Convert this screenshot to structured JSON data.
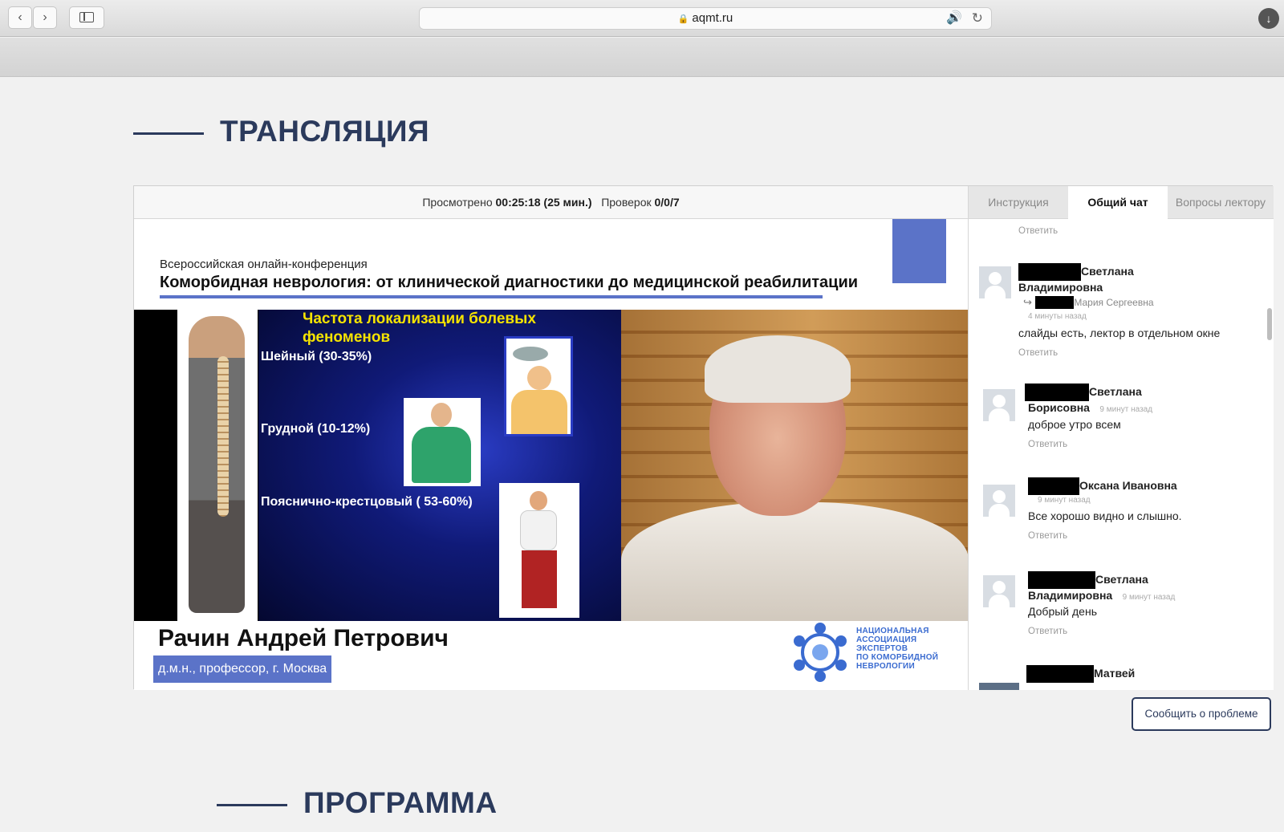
{
  "browser": {
    "url": "aqmt.ru",
    "back_icon": "chevron-left-icon",
    "forward_icon": "chevron-right-icon",
    "sidebar_icon": "sidebar-icon"
  },
  "page": {
    "broadcast_title": "ТРАНСЛЯЦИЯ",
    "program_title": "ПРОГРАММА",
    "report_button": "Сообщить о проблеме"
  },
  "stats": {
    "watched_label": "Просмотрено",
    "watched_value": "00:25:18 (25 мин.)",
    "checks_label": "Проверок",
    "checks_value": "0/0/7"
  },
  "video": {
    "conf_subtitle": "Всероссийская онлайн-конференция",
    "conf_title": "Коморбидная неврология: от клинической диагностики до медицинской реабилитации",
    "slide_heading_line1": "Частота локализации болевых",
    "slide_heading_line2": "феноменов",
    "slide_items": [
      "Шейный (30-35%)",
      "Грудной  (10-12%)",
      "Пояснично-крестцовый  ( 53-60%)"
    ],
    "speaker_name": "Рачин Андрей Петрович",
    "speaker_credentials": "д.м.н., профессор, г. Москва",
    "logo_lines": [
      "НАЦИОНАЛЬНАЯ",
      "АССОЦИАЦИЯ",
      "ЭКСПЕРТОВ",
      "ПО КОМОРБИДНОЙ",
      "НЕВРОЛОГИИ"
    ]
  },
  "chat": {
    "tabs": [
      "Инструкция",
      "Общий чат",
      "Вопросы лектору"
    ],
    "active_tab": "Общий чат",
    "reply_label": "Ответить",
    "messages": [
      {
        "name_line1": "Светлана",
        "name_line2": "Владимировна",
        "reply_to": "Мария Сергеевна",
        "time": "4 минуты назад",
        "text": "слайды есть, лектор в отдельном окне"
      },
      {
        "name_line1": "Светлана",
        "name_line2": "Борисовна",
        "time": "9 минут назад",
        "text": "доброе утро всем"
      },
      {
        "name_line1": "Оксана Ивановна",
        "time": "9 минут назад",
        "text": "Все хорошо видно и слышно."
      },
      {
        "name_line1": "Светлана",
        "name_line2": "Владимировна",
        "time": "9 минут назад",
        "text": "Добрый день"
      },
      {
        "name_line1": "Матвей"
      }
    ]
  }
}
